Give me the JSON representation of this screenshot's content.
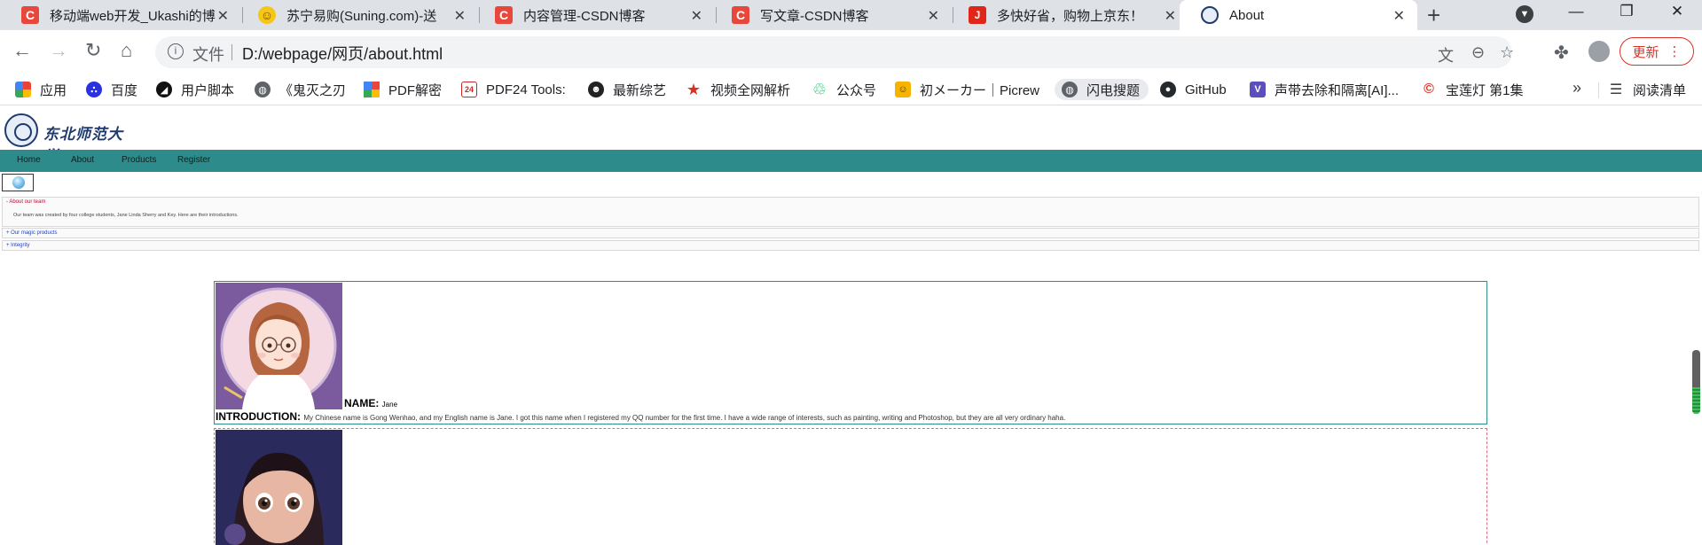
{
  "tabs": [
    {
      "title": "移动端web开发_Ukashi的博",
      "icon": "csdn-icon",
      "color": "#e8473b"
    },
    {
      "title": "苏宁易购(Suning.com)-送",
      "icon": "suning-icon",
      "color": "#f5c518"
    },
    {
      "title": "内容管理-CSDN博客",
      "icon": "csdn-icon",
      "color": "#e8473b"
    },
    {
      "title": "写文章-CSDN博客",
      "icon": "csdn-icon",
      "color": "#e8473b"
    },
    {
      "title": "多快好省，购物上京东！",
      "icon": "jd-icon",
      "color": "#e1251b"
    },
    {
      "title": "About",
      "icon": "university-seal-icon",
      "color": "#1f3b6e",
      "active": true
    }
  ],
  "toolbar": {
    "scheme": "文件",
    "url": "D:/webpage/网页/about.html",
    "update_label": "更新"
  },
  "bookmarks": [
    {
      "label": "应用",
      "icon": "apps-grid-icon",
      "color": "#4285f4"
    },
    {
      "label": "百度",
      "icon": "baidu-paw-icon",
      "color": "#2932e1"
    },
    {
      "label": "用户脚本",
      "icon": "userscript-icon",
      "color": "#111111"
    },
    {
      "label": "《鬼灭之刃",
      "icon": "globe-icon",
      "color": "#5f6368"
    },
    {
      "label": "PDF解密",
      "icon": "pdf-decrypt-icon",
      "color": "#e8473b"
    },
    {
      "label": "PDF24 Tools:",
      "icon": "pdf24-icon",
      "color": "#c62828"
    },
    {
      "label": "最新综艺",
      "icon": "variety-icon",
      "color": "#222222"
    },
    {
      "label": "视频全网解析",
      "icon": "star-icon",
      "color": "#d93025"
    },
    {
      "label": "公众号",
      "icon": "wechat-icon",
      "color": "#07c160"
    },
    {
      "label": "初メーカー｜Picrew",
      "icon": "picrew-icon",
      "color": "#f4b400"
    },
    {
      "label": "闪电搜题",
      "icon": "globe-icon",
      "color": "#5f6368",
      "highlight": true
    },
    {
      "label": "GitHub",
      "icon": "github-icon",
      "color": "#24292e"
    },
    {
      "label": "声带去除和隔离[AI]...",
      "icon": "vocal-remover-icon",
      "color": "#5b4fbb"
    },
    {
      "label": "宝莲灯 第1集",
      "icon": "video-icon",
      "color": "#d93025"
    }
  ],
  "reading_list": "阅读清单",
  "site": {
    "logo_text": "东北师范大学",
    "nav": [
      "Home",
      "About",
      "Products",
      "Register"
    ],
    "accordion": [
      {
        "title": "- About our team",
        "color": "#cc0033",
        "body": "Our team was created by four college students, Jane Linda Sherry and Key. Here are their introductions."
      },
      {
        "title": "+ Our magic products",
        "color": "#1a3fd1"
      },
      {
        "title": "+ Integrity",
        "color": "#1a3fd1"
      }
    ],
    "members": [
      {
        "name_label": "NAME:",
        "name": "Jane",
        "intro_label": "INTRODUCTION:",
        "intro": "My Chinese name is Gong Wenhao, and my English name is Jane. I got this name when I registered my QQ number for the first time. I have a wide range of interests, such as painting, writing and Photoshop, but they are all very ordinary haha."
      }
    ]
  }
}
